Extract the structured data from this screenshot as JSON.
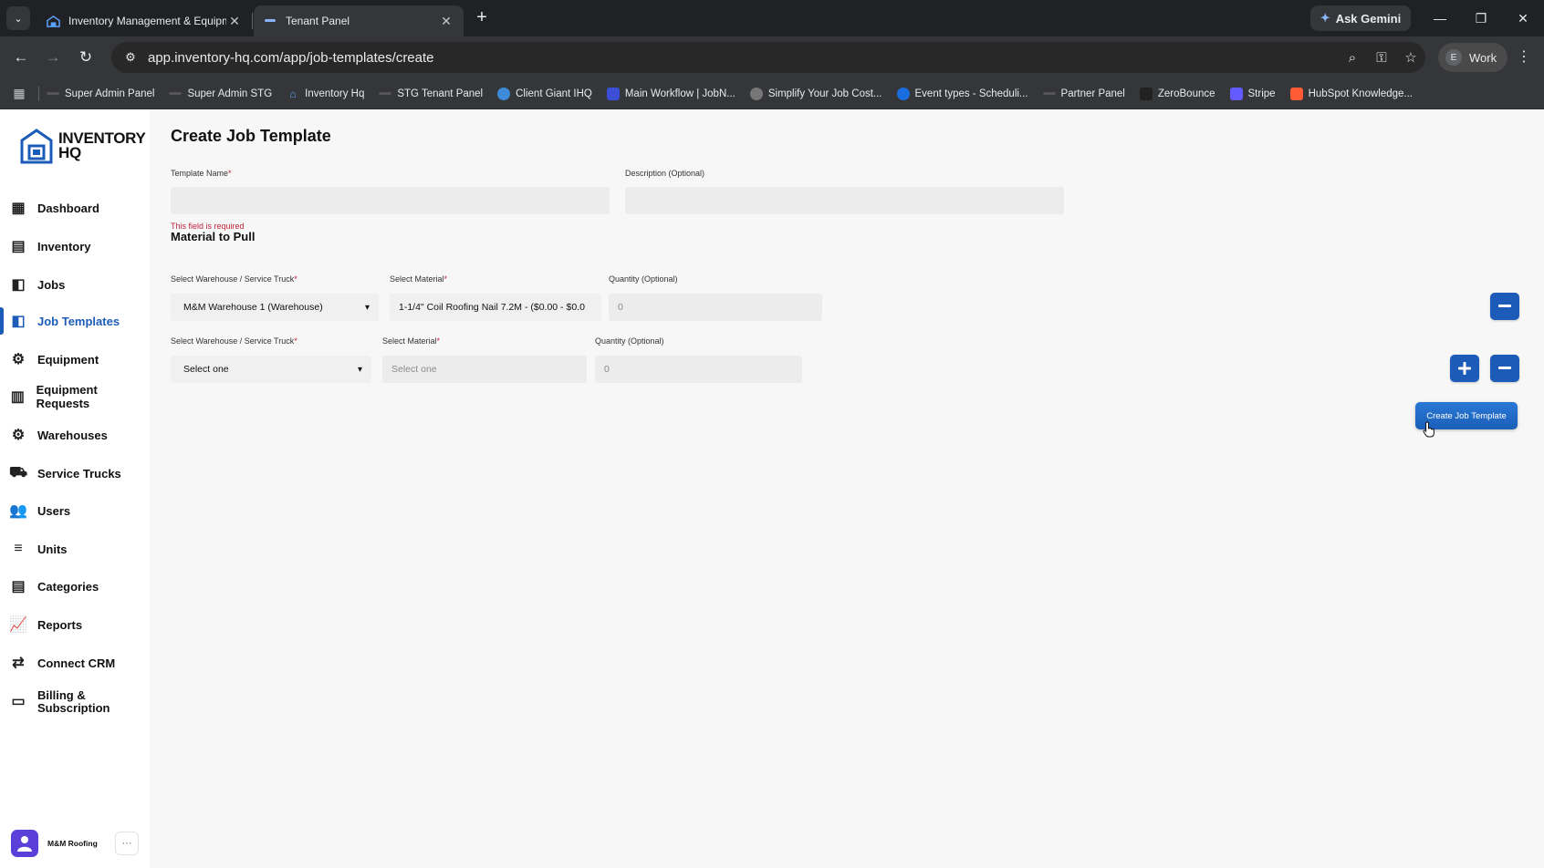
{
  "browser": {
    "tabs": [
      {
        "title": "Inventory Management & Equipm"
      },
      {
        "title": "Tenant Panel"
      }
    ],
    "ask_gemini": "Ask Gemini",
    "url": "app.inventory-hq.com/app/job-templates/create",
    "profile": {
      "initial": "E",
      "name": "Work"
    },
    "bookmarks": [
      {
        "label": "Super Admin Panel"
      },
      {
        "label": "Super Admin STG"
      },
      {
        "label": "Inventory Hq"
      },
      {
        "label": "STG Tenant Panel"
      },
      {
        "label": "Client Giant IHQ"
      },
      {
        "label": "Main Workflow | JobN..."
      },
      {
        "label": "Simplify Your Job Cost..."
      },
      {
        "label": "Event types - Scheduli..."
      },
      {
        "label": "Partner Panel"
      },
      {
        "label": "ZeroBounce"
      },
      {
        "label": "Stripe"
      },
      {
        "label": "HubSpot Knowledge..."
      }
    ]
  },
  "brand": {
    "line1": "INVENTORY",
    "line2": "HQ"
  },
  "sidebar": {
    "items": [
      {
        "label": "Dashboard",
        "icon": "dashboard-icon"
      },
      {
        "label": "Inventory",
        "icon": "inventory-icon"
      },
      {
        "label": "Jobs",
        "icon": "jobs-icon"
      },
      {
        "label": "Job Templates",
        "icon": "job-templates-icon",
        "active": true
      },
      {
        "label": "Equipment",
        "icon": "equipment-icon"
      },
      {
        "label": "Equipment Requests",
        "icon": "equipment-requests-icon"
      },
      {
        "label": "Warehouses",
        "icon": "warehouses-icon"
      },
      {
        "label": "Service Trucks",
        "icon": "truck-icon"
      },
      {
        "label": "Users",
        "icon": "users-icon"
      },
      {
        "label": "Units",
        "icon": "units-icon"
      },
      {
        "label": "Categories",
        "icon": "categories-icon"
      },
      {
        "label": "Reports",
        "icon": "reports-icon"
      },
      {
        "label": "Connect CRM",
        "icon": "crm-icon"
      },
      {
        "label": "Billing & Subscription",
        "icon": "billing-icon"
      }
    ],
    "account": {
      "name": "M&M Roofing",
      "more": "···"
    }
  },
  "page": {
    "title": "Create Job Template",
    "template_name": {
      "label": "Template Name",
      "value": "",
      "error": "This field is required"
    },
    "description": {
      "label": "Description (Optional)",
      "value": ""
    },
    "section_title": "Material to Pull",
    "rows": [
      {
        "warehouse_label": "Select Warehouse / Service Truck",
        "warehouse_value": "M&M Warehouse 1 (Warehouse)",
        "material_label": "Select Material",
        "material_value": "1-1/4\" Coil Roofing Nail 7.2M - ($0.00 - $0.0",
        "quantity_label": "Quantity (Optional)",
        "quantity_placeholder": "0"
      },
      {
        "warehouse_label": "Select Warehouse / Service Truck",
        "warehouse_value": "Select one",
        "material_label": "Select Material",
        "material_placeholder": "Select one",
        "quantity_label": "Quantity (Optional)",
        "quantity_placeholder": "0"
      }
    ],
    "required_mark": "*",
    "create_button": "Create Job Template"
  },
  "colors": {
    "accent": "#1c5cb8",
    "error": "#c0243a",
    "chrome_dark": "#202124",
    "chrome_toolbar": "#35363a"
  }
}
